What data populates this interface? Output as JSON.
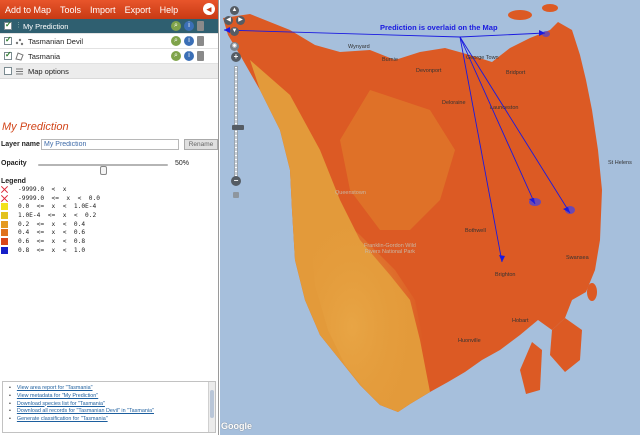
{
  "menu": {
    "items": [
      "Add to Map",
      "Tools",
      "Import",
      "Export",
      "Help"
    ],
    "collapse_glyph": "◂"
  },
  "layers": [
    {
      "label": "My Prediction",
      "checked": true,
      "selected": true,
      "icon": "grid-icon"
    },
    {
      "label": "Tasmanian Devil",
      "checked": true,
      "selected": false,
      "icon": "points-icon"
    },
    {
      "label": "Tasmania",
      "checked": true,
      "selected": false,
      "icon": "polygon-icon"
    }
  ],
  "map_options_label": "Map options",
  "details": {
    "title": "My Prediction",
    "layer_name_label": "Layer name",
    "layer_name_value": "My Prediction",
    "rename_label": "Rename",
    "opacity_label": "Opacity",
    "opacity_value": "50%",
    "opacity_fraction": 0.5
  },
  "legend": {
    "title": "Legend",
    "entries": [
      {
        "text": "-9999.0  <  x",
        "color": "none"
      },
      {
        "text": "-9999.0  <=  x  <  0.0",
        "color": "none"
      },
      {
        "text": "0.0  <=  x  <  1.0E-4",
        "color": "#f2e21a"
      },
      {
        "text": "1.0E-4  <=  x  <  0.2",
        "color": "#e3c21f"
      },
      {
        "text": "0.2  <=  x  <  0.4",
        "color": "#e59a20"
      },
      {
        "text": "0.4  <=  x  <  0.6",
        "color": "#e0721e"
      },
      {
        "text": "0.6  <=  x  <  0.8",
        "color": "#d8451b"
      },
      {
        "text": "0.8  <=  x  <  1.0",
        "color": "#1620c8"
      }
    ]
  },
  "links": [
    "View area report for \"Tasmania\"",
    "View metadata for \"My Prediction\"",
    "Download species list for \"Tasmania\"",
    "Download all records for \"Tasmanian Devil\" in \"Tasmania\"",
    "Generate classification for \"Tasmania\""
  ],
  "map": {
    "annotation": "Prediction is overlaid on the Map",
    "attribution": "Google",
    "places": [
      "Wynyard",
      "Burnie",
      "Devonport",
      "George Town",
      "Bridport",
      "St Helens",
      "Launceston",
      "Deloraine",
      "Queenstown",
      "Franklin-Gordon Wild Rivers National Park",
      "Bothwell",
      "Swansea",
      "Brighton",
      "Hobart",
      "Huonville"
    ],
    "colors": {
      "sea": "#a6bfdc",
      "high": "#dc5a24",
      "mid": "#e0792a",
      "low": "#e39a3a",
      "hotspot": "#4f43d8",
      "arrow": "#1a1ae0"
    }
  }
}
